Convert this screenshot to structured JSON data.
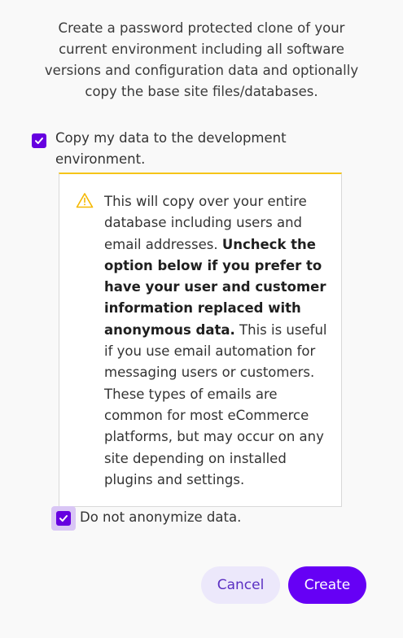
{
  "intro": {
    "text": "Create a password protected clone of your current environment including all software versions and configuration data and optionally copy the base site files/databases."
  },
  "copy_data": {
    "label": "Copy my data to the development environment.",
    "checked": true
  },
  "warning": {
    "icon": "warning-triangle-icon",
    "text_part1": "This will copy over your entire database including users and email addresses. ",
    "text_bold": "Uncheck the option below if you prefer to have your user and customer information replaced with anonymous data.",
    "text_part2": " This is useful if you use email automation for messaging users or customers. These types of emails are common for most eCommerce platforms, but may occur on any site depending on installed plugins and settings.",
    "accent_color": "#f5c518"
  },
  "anonymize": {
    "label": "Do not anonymize data.",
    "checked": true
  },
  "actions": {
    "cancel_label": "Cancel",
    "create_label": "Create"
  },
  "colors": {
    "primary": "#6600f5",
    "checkbox": "#6600e0",
    "cancel_bg": "#ece8fb",
    "cancel_text": "#5a2fc2",
    "focus_ring": "#d9c6f5"
  }
}
